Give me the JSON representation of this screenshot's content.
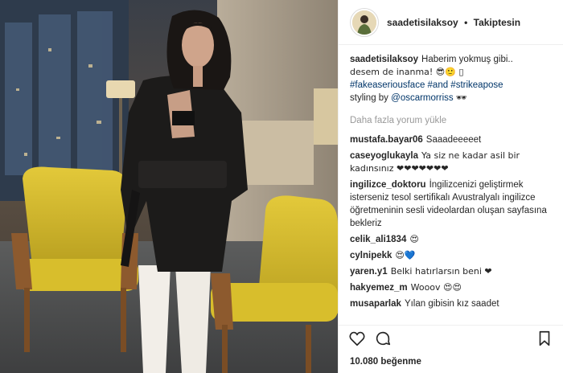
{
  "header": {
    "username": "saadetisilaksoy",
    "separator": "•",
    "follow_status": "Takiptesin",
    "avatar_icon": "avatar-profile-icon"
  },
  "caption": {
    "username": "saadetisilaksoy",
    "line1": "Haberim yokmuş gibi..",
    "line2": "desem de inanma! 😎🙂 ▯",
    "hashtags": "#fakeaseriousface #and #strikeapose",
    "styling_prefix": "styling by",
    "styling_mention": "@oscarmorriss",
    "styling_emoji": "🕶"
  },
  "load_more": "Daha fazla yorum yükle",
  "comments": [
    {
      "username": "mustafa.bayar06",
      "text": "Saaadeeeeet"
    },
    {
      "username": "caseyoglukayla",
      "text": "Ya siz ne kadar asil bir kadınsınız ❤❤❤❤❤❤❤"
    },
    {
      "username": "ingilizce_doktoru",
      "text": "İngilizcenizi geliştirmek isterseniz tesol sertifikalı Avustralyalı ingilizce öğretmeninin sesli videolardan oluşan sayfasına bekleriz"
    },
    {
      "username": "celik_ali1834",
      "text": "😍"
    },
    {
      "username": "cylnipekk",
      "text": "😍💙"
    },
    {
      "username": "yaren.y1",
      "text": "Belki hatırlarsın beni ❤"
    },
    {
      "username": "hakyemez_m",
      "text": "Wooov 😍😍"
    },
    {
      "username": "musaparlak",
      "text": "Yılan gibisin kız saadet"
    }
  ],
  "actions": {
    "like_icon": "heart-icon",
    "comment_icon": "comment-icon",
    "save_icon": "bookmark-icon"
  },
  "likes_text": "10.080 beğenme",
  "colors": {
    "text": "#262626",
    "muted": "#999999",
    "hashtag": "#003569",
    "border": "#efefef"
  }
}
